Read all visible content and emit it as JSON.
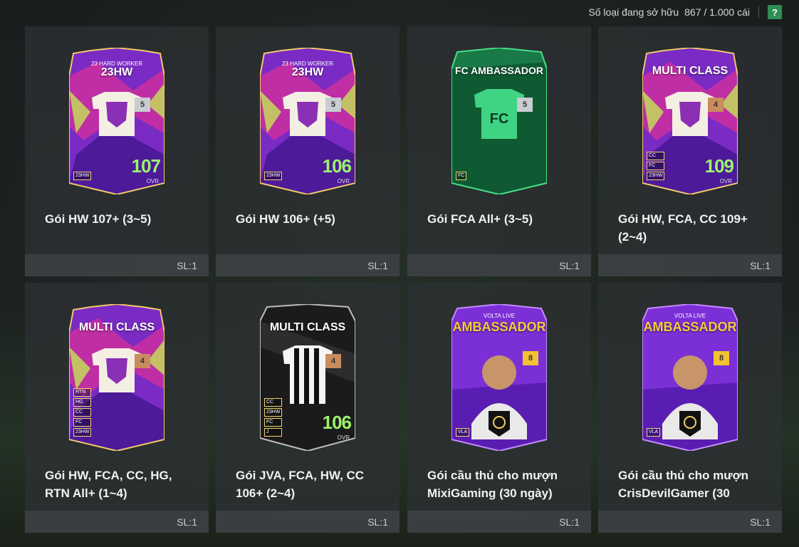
{
  "header": {
    "owned_label": "Số loại đang sở hữu",
    "owned_value": "867 / 1.000 cái",
    "help_label": "?"
  },
  "packs": [
    {
      "name": "Gói HW 107+ (3~5)",
      "qty": "SL:1",
      "card": {
        "style": "hw",
        "title": "23HW",
        "subtitle": "23 HARD WORKER",
        "level": "5",
        "ovr": "107",
        "ovr_label": "OVR",
        "tags": [
          "23HW"
        ]
      }
    },
    {
      "name": "Gói HW 106+ (+5)",
      "qty": "SL:1",
      "card": {
        "style": "hw",
        "title": "23HW",
        "subtitle": "23 HARD WORKER",
        "level": "5",
        "ovr": "106",
        "ovr_label": "OVR",
        "tags": [
          "23HW"
        ]
      }
    },
    {
      "name": "Gói FCA All+ (3~5)",
      "qty": "SL:1",
      "card": {
        "style": "fca",
        "title": "FC AMBASSADOR",
        "subtitle": "",
        "level": "5",
        "ovr": "",
        "ovr_label": "",
        "tags": [
          "FC"
        ]
      }
    },
    {
      "name": "Gói HW, FCA, CC 109+ (2~4)",
      "qty": "SL:1",
      "card": {
        "style": "hw",
        "title": "MULTI CLASS",
        "subtitle": "",
        "level": "4",
        "ovr": "109",
        "ovr_label": "OVR",
        "tags": [
          "CC",
          "FC",
          "23HW"
        ]
      }
    },
    {
      "name": "Gói HW, FCA, CC, HG, RTN All+ (1~4)",
      "qty": "SL:1",
      "card": {
        "style": "hw",
        "title": "MULTI CLASS",
        "subtitle": "",
        "level": "4",
        "ovr": "",
        "ovr_label": "",
        "tags": [
          "RTN",
          "HG",
          "CC",
          "FC",
          "23HW"
        ]
      }
    },
    {
      "name": "Gói JVA, FCA, HW, CC 106+ (2~4)",
      "qty": "SL:1",
      "card": {
        "style": "juve",
        "title": "MULTI CLASS",
        "subtitle": "",
        "level": "4",
        "ovr": "106",
        "ovr_label": "OVR",
        "tags": [
          "CC",
          "23HW",
          "FC",
          "J"
        ]
      }
    },
    {
      "name": "Gói cầu thủ cho mượn MixiGaming (30 ngày)",
      "qty": "SL:1",
      "card": {
        "style": "volta",
        "title": "AMBASSADOR",
        "subtitle": "VOLTA LIVE",
        "level": "8",
        "ovr": "",
        "ovr_label": "",
        "tags": [
          "VLA"
        ]
      }
    },
    {
      "name": "Gói cầu thủ cho mượn CrisDevilGamer (30",
      "qty": "SL:1",
      "card": {
        "style": "volta",
        "title": "AMBASSADOR",
        "subtitle": "VOLTA LIVE",
        "level": "8",
        "ovr": "",
        "ovr_label": "",
        "tags": [
          "VLA"
        ]
      }
    }
  ]
}
